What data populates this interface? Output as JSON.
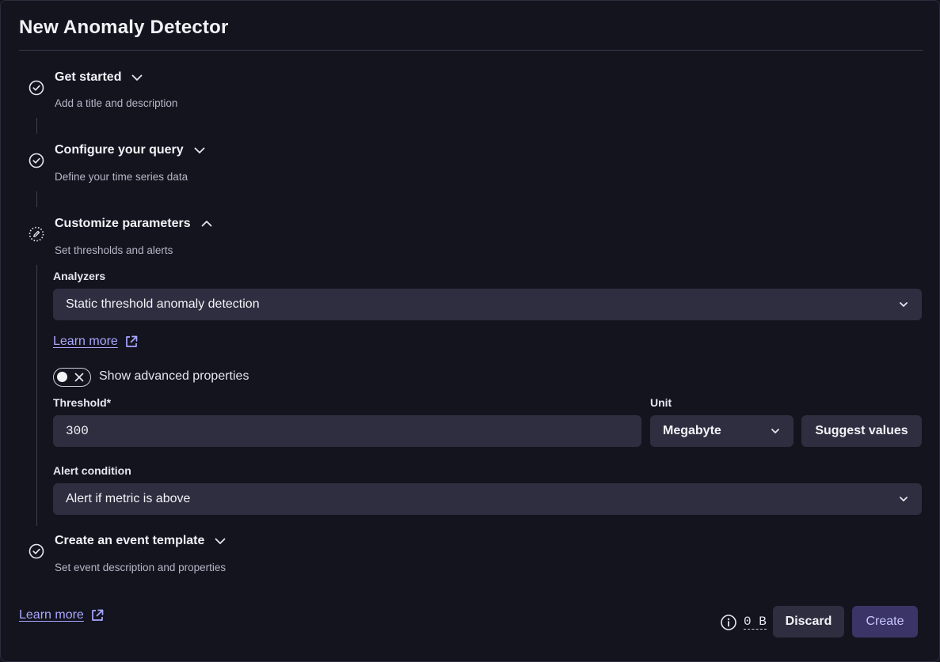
{
  "dialog": {
    "title": "New Anomaly Detector"
  },
  "steps": [
    {
      "title": "Get started",
      "subtitle": "Add a title and description",
      "status": "complete",
      "expanded": false
    },
    {
      "title": "Configure your query",
      "subtitle": "Define your time series data",
      "status": "complete",
      "expanded": false
    },
    {
      "title": "Customize parameters",
      "subtitle": "Set thresholds and alerts",
      "status": "in-progress",
      "expanded": true
    },
    {
      "title": "Create an event template",
      "subtitle": "Set event description and properties",
      "status": "complete",
      "expanded": false
    }
  ],
  "parameters": {
    "analyzers_label": "Analyzers",
    "analyzer_value": "Static threshold anomaly detection",
    "learn_more": "Learn more",
    "advanced_toggle_label": "Show advanced properties",
    "advanced_toggle_on": false,
    "threshold_label": "Threshold*",
    "threshold_value": "300",
    "unit_label": "Unit",
    "unit_value": "Megabyte",
    "suggest_button": "Suggest values",
    "alert_condition_label": "Alert condition",
    "alert_condition_value": "Alert if metric is above"
  },
  "footer": {
    "learn_more": "Learn more",
    "size": "0 B",
    "discard": "Discard",
    "create": "Create"
  },
  "icons": {
    "complete": "check-circle-icon",
    "in_progress": "dotted-circle-edit-icon",
    "expand": "chevron-down-icon",
    "collapse": "chevron-up-icon",
    "external": "external-link-icon",
    "info": "info-icon"
  },
  "colors": {
    "background": "#14141f",
    "field": "#2e2e40",
    "link": "#a8a7ff",
    "primary_button": "#3a3566"
  }
}
